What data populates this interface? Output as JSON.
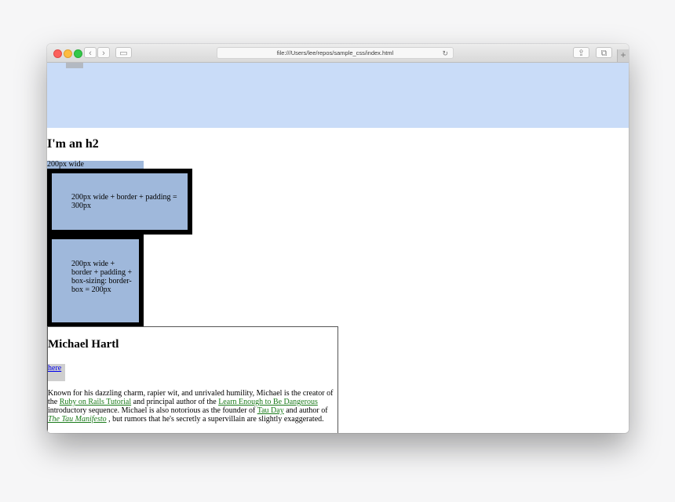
{
  "browser": {
    "url": "file:///Users/lee/repos/sample_css/index.html",
    "back_glyph": "‹",
    "forward_glyph": "›",
    "reload_glyph": "↻",
    "share_glyph": "⇪",
    "tabs_glyph": "⧉",
    "sidebar_glyph": "▭",
    "newtab_glyph": "+"
  },
  "page": {
    "heading": "I'm an h2",
    "box_200": "200px wide",
    "box_content_box": "200px wide + border + padding = 300px",
    "box_border_box": "200px wide + border + padding + box-sizing: border-box = 200px"
  },
  "bio": {
    "name": "Michael Hartl",
    "photo_link": "here",
    "text_1": "Known for his dazzling charm, rapier wit, and unrivaled humility, Michael is the creator of the ",
    "link_rails": "Ruby on Rails Tutorial",
    "text_2": " and principal author of the ",
    "link_learn": "Learn Enough to Be Dangerous",
    "text_3": " introductory sequence. Michael is also notorious as the founder of ",
    "link_tau_day": "Tau Day",
    "text_4": " and author of ",
    "link_tau_manifesto": "The Tau Manifesto",
    "text_5": " , but rumors that he's secretly a supervillain are slightly exaggerated."
  },
  "colors": {
    "banner": "#c9dcf8",
    "box_fill": "#9fb8db",
    "link": "#1a7a1a"
  }
}
